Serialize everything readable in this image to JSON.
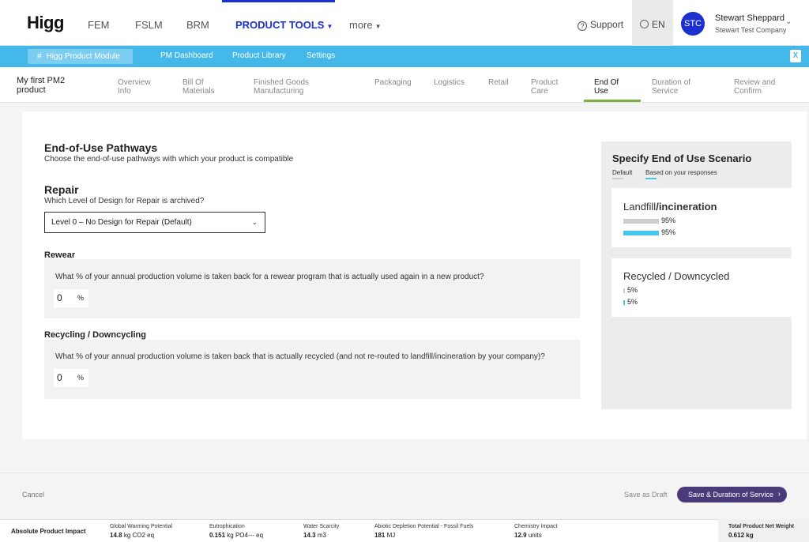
{
  "header": {
    "logo": "Higg",
    "nav": [
      "FEM",
      "FSLM",
      "BRM",
      "PRODUCT TOOLS",
      "more"
    ],
    "support": "Support",
    "language": "EN",
    "avatar_initials": "STC",
    "user_name": "Stewart Sheppard",
    "user_company": "Stewart Test Company"
  },
  "subnav": {
    "module": "Higg Product Module",
    "links": [
      "PM Dashboard",
      "Product Library",
      "Settings"
    ],
    "export_icon": "excel-icon"
  },
  "product_name": "My first PM2 product",
  "steps": [
    {
      "label": "Overview Info",
      "active": false
    },
    {
      "label": "Bill Of Materials",
      "active": false
    },
    {
      "label": "Finished Goods Manufacturing",
      "active": false
    },
    {
      "label": "Packaging",
      "active": false
    },
    {
      "label": "Logistics",
      "active": false
    },
    {
      "label": "Retail",
      "active": false
    },
    {
      "label": "Product Care",
      "active": false
    },
    {
      "label": "End Of Use",
      "active": true
    },
    {
      "label": "Duration of Service",
      "active": false
    },
    {
      "label": "Review and Confirm",
      "active": false
    }
  ],
  "main": {
    "title": "End-of-Use Pathways",
    "subtitle": "Choose the end-of-use pathways with which your product is compatible",
    "repair": {
      "title": "Repair",
      "question": "Which Level of Design for Repair is archived?",
      "selected": "Level 0 – No Design for Repair (Default)"
    },
    "rewear": {
      "title": "Rewear",
      "question": "What % of your annual production volume is taken back for a rewear program that is actually used again in a new product?",
      "value": "0",
      "unit": "%"
    },
    "recycling": {
      "title": "Recycling / Downcycling",
      "question": "What % of your annual production volume is taken back that is actually recycled (and not re-routed to landfill/incineration by your company)?",
      "value": "0",
      "unit": "%"
    }
  },
  "scenario": {
    "title": "Specify End of Use Scenario",
    "legend_default": "Default",
    "legend_responses": "Based on your responses",
    "default_color": "#cccccc",
    "response_color": "#45c6ee",
    "items": [
      {
        "title_prefix": "Landfill",
        "title_bold": "/incineration",
        "default_pct": 95,
        "default_label": "95%",
        "response_pct": 95,
        "response_label": "95%"
      },
      {
        "title_prefix": "Recycled / Downcycled",
        "title_bold": "",
        "default_pct": 5,
        "default_label": "5%",
        "response_pct": 5,
        "response_label": "5%"
      }
    ]
  },
  "footer": {
    "cancel": "Cancel",
    "save_draft": "Save as Draft",
    "save_next": "Save & Duration of Service"
  },
  "impact": {
    "title": "Absolute Product Impact",
    "metrics": [
      {
        "label": "Global Warming Potential",
        "value": "14.8",
        "unit": "kg CO2 eq"
      },
      {
        "label": "Eutrophication",
        "value": "0.151",
        "unit": "kg PO4--- eq"
      },
      {
        "label": "Water Scarcity",
        "value": "14.3",
        "unit": "m3"
      },
      {
        "label": "Abiotic Depletion Potential - Fossil Fuels",
        "value": "181",
        "unit": "MJ"
      },
      {
        "label": "Chemistry Impact",
        "value": "12.9",
        "unit": "units"
      }
    ],
    "net_weight_label": "Total Product Net Weight",
    "net_weight_value": "0.612 kg"
  }
}
